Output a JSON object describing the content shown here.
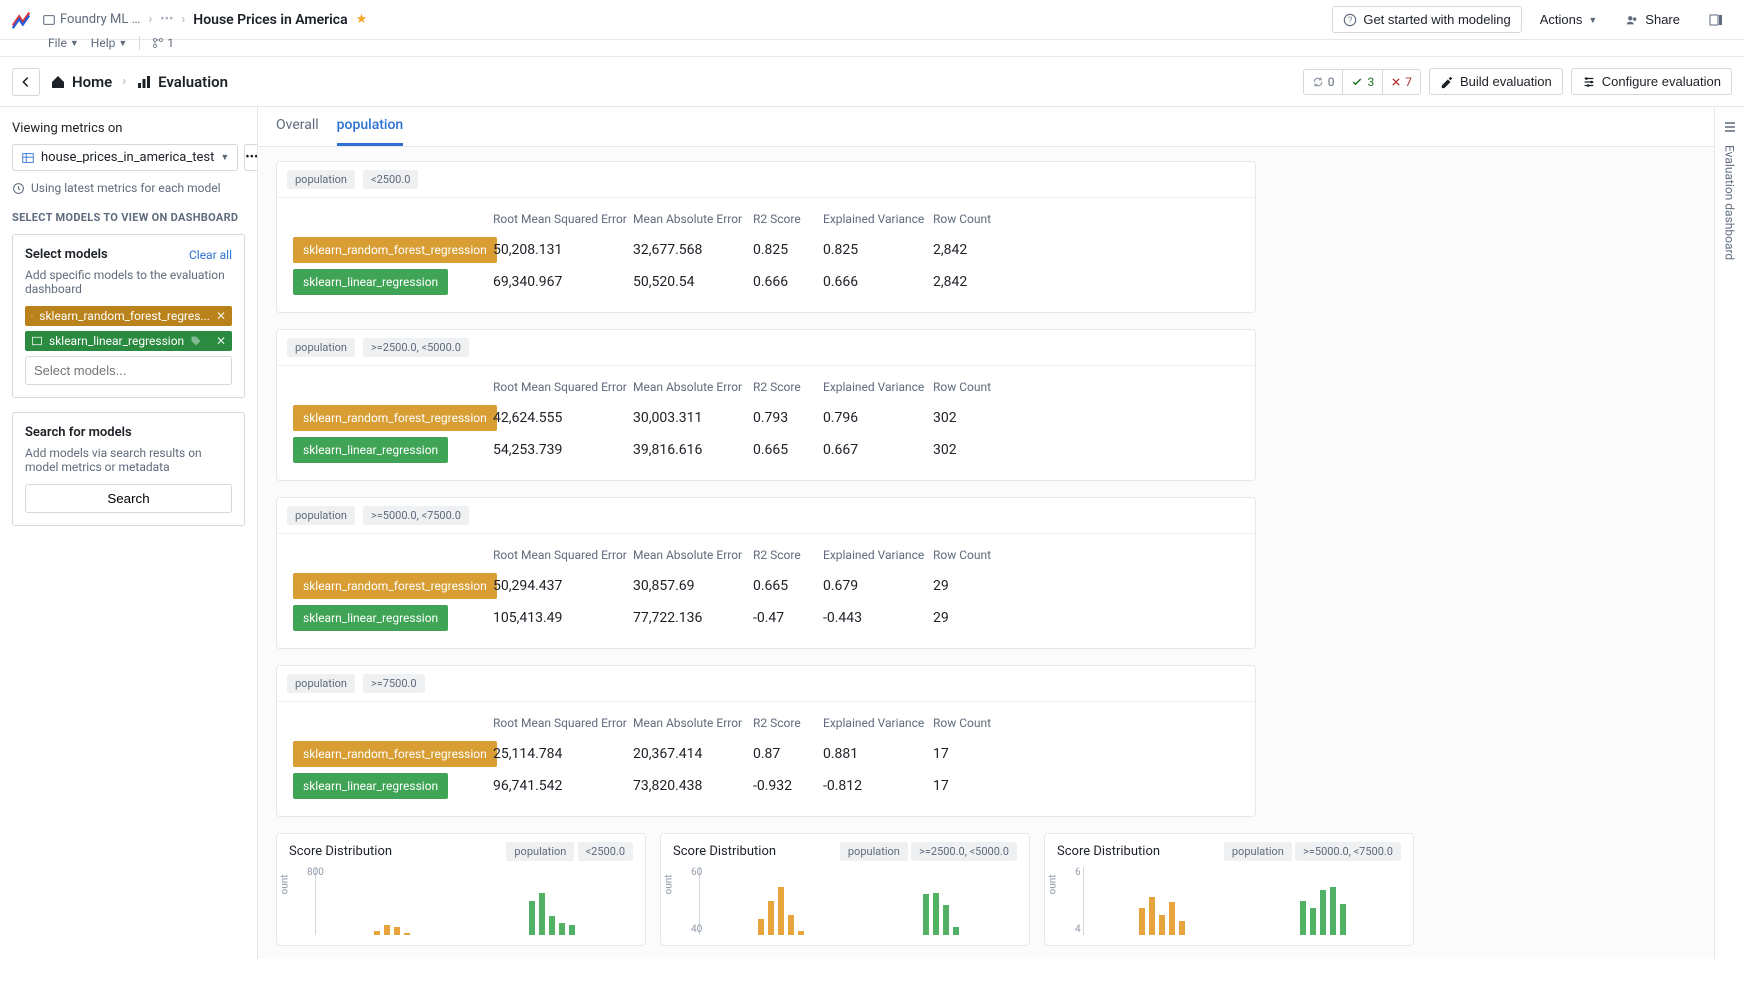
{
  "topbar": {
    "project": "Foundry ML …",
    "title": "House Prices in America",
    "file": "File",
    "help": "Help",
    "branch": "1",
    "get_started": "Get started with modeling",
    "actions": "Actions",
    "share": "Share"
  },
  "nav": {
    "home": "Home",
    "evaluation": "Evaluation",
    "status_refresh": "0",
    "status_ok": "3",
    "status_err": "7",
    "build": "Build evaluation",
    "configure": "Configure evaluation"
  },
  "sidebar": {
    "viewing_label": "Viewing metrics on",
    "dataset": "house_prices_in_america_test",
    "latest": "Using latest metrics for each model",
    "section": "SELECT MODELS TO VIEW ON DASHBOARD",
    "select_title": "Select models",
    "clear": "Clear all",
    "select_desc": "Add specific models to the evaluation dashboard",
    "chip1": "sklearn_random_forest_regres...",
    "chip2": "sklearn_linear_regression",
    "select_placeholder": "Select models...",
    "search_title": "Search for models",
    "search_desc": "Add models via search results on model metrics or metadata",
    "search_btn": "Search"
  },
  "tabs": {
    "overall": "Overall",
    "population": "population"
  },
  "headers": [
    "Root Mean Squared Error",
    "Mean Absolute Error",
    "R2 Score",
    "Explained Variance",
    "Row Count"
  ],
  "models": {
    "rf": "sklearn_random_forest_regression",
    "lr": "sklearn_linear_regression"
  },
  "panels": [
    {
      "label": "population",
      "range": "<2500.0",
      "rows": [
        {
          "m": "rf",
          "v": [
            "50,208.131",
            "32,677.568",
            "0.825",
            "0.825",
            "2,842"
          ]
        },
        {
          "m": "lr",
          "v": [
            "69,340.967",
            "50,520.54",
            "0.666",
            "0.666",
            "2,842"
          ]
        }
      ]
    },
    {
      "label": "population",
      "range": ">=2500.0, <5000.0",
      "rows": [
        {
          "m": "rf",
          "v": [
            "42,624.555",
            "30,003.311",
            "0.793",
            "0.796",
            "302"
          ]
        },
        {
          "m": "lr",
          "v": [
            "54,253.739",
            "39,816.616",
            "0.665",
            "0.667",
            "302"
          ]
        }
      ]
    },
    {
      "label": "population",
      "range": ">=5000.0, <7500.0",
      "rows": [
        {
          "m": "rf",
          "v": [
            "50,294.437",
            "30,857.69",
            "0.665",
            "0.679",
            "29"
          ]
        },
        {
          "m": "lr",
          "v": [
            "105,413.49",
            "77,722.136",
            "-0.47",
            "-0.443",
            "29"
          ]
        }
      ]
    },
    {
      "label": "population",
      "range": ">=7500.0",
      "rows": [
        {
          "m": "rf",
          "v": [
            "25,114.784",
            "20,367.414",
            "0.87",
            "0.881",
            "17"
          ]
        },
        {
          "m": "lr",
          "v": [
            "96,741.542",
            "73,820.438",
            "-0.932",
            "-0.812",
            "17"
          ]
        }
      ]
    }
  ],
  "charts_title": "Score Distribution",
  "charts": [
    {
      "label": "population",
      "range": "<2500.0",
      "ylab": "ount",
      "ytick": "800"
    },
    {
      "label": "population",
      "range": ">=2500.0, <5000.0",
      "ylab": "ount",
      "ytick": "60",
      "ytick2": "40"
    },
    {
      "label": "population",
      "range": ">=5000.0, <7500.0",
      "ylab": "ount",
      "ytick": "6",
      "ytick2": "4"
    }
  ],
  "chart_data": [
    {
      "type": "bar",
      "title": "Score Distribution",
      "ylabel": "count",
      "categories_note": "score bins (x-axis unlabeled)",
      "series": [
        {
          "name": "sklearn_random_forest_regression",
          "values": [
            60,
            250,
            180,
            40,
            0,
            0,
            0,
            0,
            0
          ]
        },
        {
          "name": "sklearn_linear_regression",
          "values": [
            0,
            0,
            0,
            0,
            820,
            920,
            420,
            250,
            200
          ]
        }
      ],
      "ylim": [
        0,
        1000
      ]
    },
    {
      "type": "bar",
      "title": "Score Distribution",
      "ylabel": "count",
      "series": [
        {
          "name": "sklearn_random_forest_regression",
          "values": [
            24,
            50,
            70,
            30,
            6,
            0,
            0,
            0,
            0
          ]
        },
        {
          "name": "sklearn_linear_regression",
          "values": [
            0,
            0,
            0,
            0,
            0,
            60,
            62,
            44,
            12
          ]
        }
      ],
      "ylim": [
        0,
        80
      ]
    },
    {
      "type": "bar",
      "title": "Score Distribution",
      "ylabel": "count",
      "series": [
        {
          "name": "sklearn_random_forest_regression",
          "values": [
            4,
            6,
            3,
            5,
            2,
            0,
            0,
            0,
            0,
            0
          ]
        },
        {
          "name": "sklearn_linear_regression",
          "values": [
            0,
            0,
            0,
            0,
            0,
            5,
            4,
            7,
            7,
            5
          ]
        }
      ],
      "ylim": [
        0,
        8
      ]
    }
  ],
  "rail": {
    "label": "Evaluation dashboard"
  }
}
